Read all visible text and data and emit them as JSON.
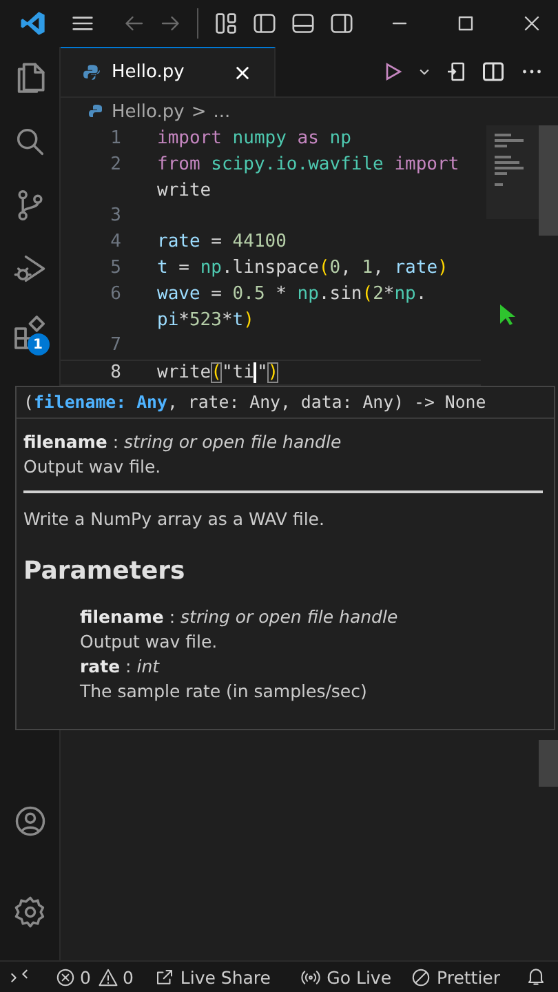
{
  "tabs": [
    {
      "label": "Hello.py",
      "selected": true
    }
  ],
  "breadcrumb": {
    "file": "Hello.py",
    "separator": ">",
    "more": "..."
  },
  "activity_bar": {
    "extensions_badge": "1"
  },
  "editor": {
    "lines": [
      {
        "number": "1",
        "current": false,
        "tokens": [
          {
            "kind": "kw",
            "text": "import"
          },
          {
            "kind": "mod",
            "text": " numpy"
          },
          {
            "kind": "kw",
            "text": " as"
          },
          {
            "kind": "mod",
            "text": " np"
          }
        ]
      },
      {
        "number": "2",
        "current": false,
        "tokens": [
          {
            "kind": "kw",
            "text": "from"
          },
          {
            "kind": "mod",
            "text": " scipy.io.wavfile"
          },
          {
            "kind": "kw",
            "text": " import"
          }
        ]
      },
      {
        "current": false,
        "tokens": [
          {
            "kind": "plain",
            "text": "write"
          }
        ]
      },
      {
        "number": "3",
        "current": false
      },
      {
        "number": "4",
        "current": false,
        "tokens": [
          {
            "kind": "var",
            "text": "rate"
          },
          {
            "kind": "plain",
            "text": " = "
          },
          {
            "kind": "num",
            "text": "44100"
          }
        ]
      },
      {
        "number": "5",
        "current": false,
        "tokens": [
          {
            "kind": "var",
            "text": "t"
          },
          {
            "kind": "plain",
            "text": " = "
          },
          {
            "kind": "mod",
            "text": "np"
          },
          {
            "kind": "plain",
            "text": ".linspace"
          },
          {
            "kind": "bracket",
            "text": "("
          },
          {
            "kind": "num",
            "text": "0"
          },
          {
            "kind": "plain",
            "text": ", "
          },
          {
            "kind": "num",
            "text": "1"
          },
          {
            "kind": "plain",
            "text": ", "
          },
          {
            "kind": "var",
            "text": "rate"
          },
          {
            "kind": "bracket",
            "text": ")"
          }
        ]
      },
      {
        "number": "6",
        "current": false,
        "tokens": [
          {
            "kind": "var",
            "text": "wave"
          },
          {
            "kind": "plain",
            "text": " = "
          },
          {
            "kind": "num",
            "text": "0.5"
          },
          {
            "kind": "plain",
            "text": " * "
          },
          {
            "kind": "mod",
            "text": "np"
          },
          {
            "kind": "plain",
            "text": ".sin"
          },
          {
            "kind": "bracket",
            "text": "("
          },
          {
            "kind": "num",
            "text": "2"
          },
          {
            "kind": "plain",
            "text": "*"
          },
          {
            "kind": "mod",
            "text": "np"
          },
          {
            "kind": "plain",
            "text": "."
          }
        ]
      },
      {
        "current": false,
        "tokens": [
          {
            "kind": "var",
            "text": "pi"
          },
          {
            "kind": "plain",
            "text": "*"
          },
          {
            "kind": "num",
            "text": "523"
          },
          {
            "kind": "plain",
            "text": "*"
          },
          {
            "kind": "var",
            "text": "t"
          },
          {
            "kind": "bracket",
            "text": ")"
          }
        ]
      },
      {
        "number": "7",
        "current": false
      },
      {
        "number": "8",
        "current": true,
        "tokens": [
          {
            "kind": "plain",
            "text": "write"
          },
          {
            "kind": "match",
            "text": "("
          },
          {
            "kind": "plain",
            "text": "\"ti"
          },
          {
            "kind": "cursor"
          },
          {
            "kind": "plain",
            "text": "\""
          },
          {
            "kind": "match",
            "text": ")"
          }
        ]
      }
    ]
  },
  "hover": {
    "signature": [
      {
        "text": "(",
        "active": false
      },
      {
        "text": "filename: Any",
        "active": true
      },
      {
        "text": ", rate: Any, data: Any) -> None",
        "active": false
      }
    ],
    "sections": [
      {
        "kind": "text",
        "indented": false,
        "text": "**filename** : *string or open file handle*"
      },
      {
        "kind": "text",
        "indented": false,
        "text": "Output wav file."
      },
      {
        "kind": "rule"
      },
      {
        "kind": "text",
        "indented": false,
        "text": "Write a NumPy array as a WAV file."
      },
      {
        "kind": "heading",
        "text": "Parameters"
      },
      {
        "kind": "text",
        "indented": true,
        "text": "**filename** : *string or open file handle*"
      },
      {
        "kind": "text",
        "indented": true,
        "text": "Output wav file."
      },
      {
        "kind": "text",
        "indented": true,
        "text": "**rate** : *int*"
      },
      {
        "kind": "text",
        "indented": true,
        "text": "The sample rate (in samples/sec)"
      }
    ]
  },
  "status_bar": {
    "problems": [
      {
        "kind": "error",
        "count": "0"
      },
      {
        "kind": "warning",
        "count": "0"
      }
    ],
    "items": [
      {
        "kind": "share",
        "label": "Live Share"
      },
      {
        "kind": "broadcast",
        "label": "Go Live"
      },
      {
        "kind": "prettier",
        "label": "Prettier"
      }
    ]
  }
}
